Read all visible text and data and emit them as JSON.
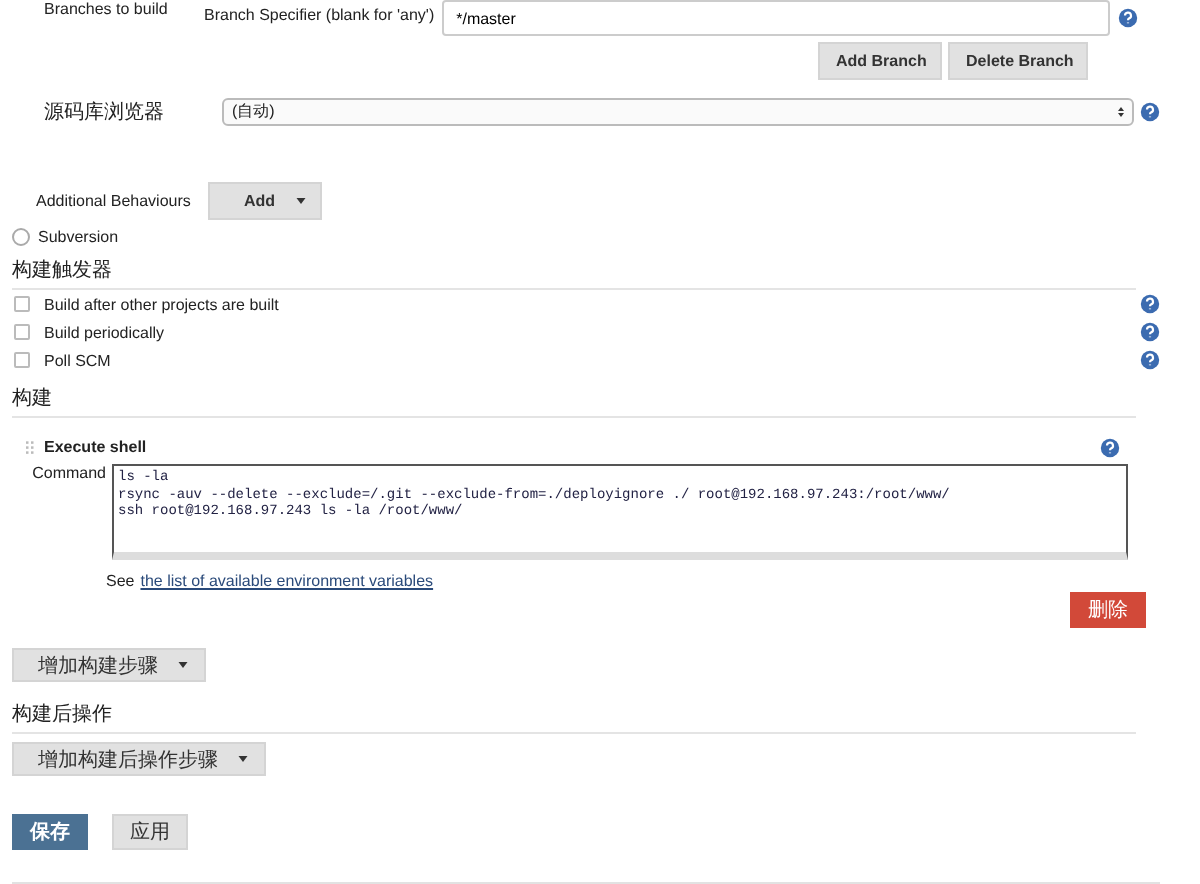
{
  "scm": {
    "branches_label": "Branches to build",
    "branch_specifier": {
      "label": "Branch Specifier (blank for 'any')",
      "value": "*/master"
    },
    "branch_buttons": [
      "Add Branch",
      "Delete Branch"
    ],
    "repo_browser": {
      "label": "源码库浏览器",
      "value": "(自动)"
    },
    "additional_behaviours": {
      "label": "Additional Behaviours",
      "button": "Add"
    },
    "subversion": {
      "label": "Subversion",
      "selected": false
    }
  },
  "triggers": {
    "title": "构建触发器",
    "options": [
      {
        "label": "Build after other projects are built",
        "checked": false
      },
      {
        "label": "Build periodically",
        "checked": false
      },
      {
        "label": "Poll SCM",
        "checked": false
      }
    ]
  },
  "build": {
    "title": "构建",
    "step": {
      "title": "Execute shell",
      "command_label": "Command",
      "command": "ls -la\nrsync -auv --delete --exclude=/.git --exclude-from=./deployignore ./ root@192.168.97.243:/root/www/\nssh root@192.168.97.243 ls -la /root/www/",
      "see": "See",
      "link": "the list of available environment variables",
      "delete": "删除"
    },
    "add_step": "增加构建步骤"
  },
  "post_build": {
    "title": "构建后操作",
    "add_step": "增加构建后操作步骤"
  },
  "actions": [
    "保存",
    "应用"
  ]
}
